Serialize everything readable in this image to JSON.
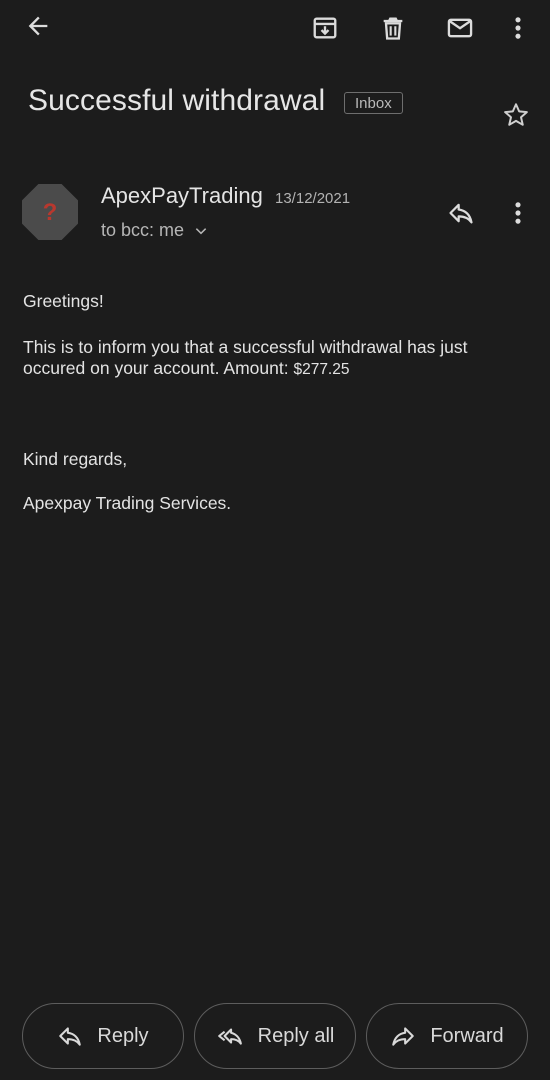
{
  "toolbar": {
    "icons": [
      "back-arrow-icon",
      "archive-icon",
      "trash-icon",
      "mail-icon",
      "more-vert-icon"
    ]
  },
  "email": {
    "subject": "Successful withdrawal",
    "label": "Inbox",
    "sender": {
      "avatar_glyph": "?",
      "name": "ApexPayTrading",
      "date": "13/12/2021",
      "to_line": "to bcc: me"
    },
    "body": {
      "greeting": "Greetings!",
      "message": "This is to inform you that a successful withdrawal has just occured on your account. Amount: ",
      "amount": "$277.25",
      "closing": "Kind regards,",
      "signature": "Apexpay Trading Services."
    }
  },
  "actions": {
    "reply": "Reply",
    "reply_all": "Reply all",
    "forward": "Forward"
  },
  "colors": {
    "background": "#1c1c1c",
    "text": "#e3e3e3",
    "muted": "#b6b6b6",
    "avatar_bg": "#4b4b4b",
    "avatar_glyph": "#b8382e"
  }
}
